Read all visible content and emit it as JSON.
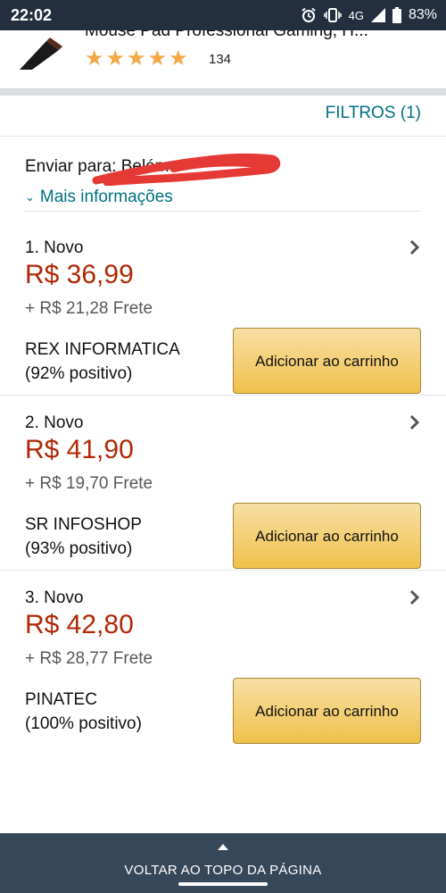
{
  "status_bar": {
    "time": "22:02",
    "network": "4G",
    "battery": "83%"
  },
  "product": {
    "title": "Mouse Pad Professional Gaming, H...",
    "rating_stars": 5,
    "review_count": "134"
  },
  "filters": {
    "label": "FILTROS (1)"
  },
  "delivery": {
    "label": "Enviar para: Belém",
    "more_info": "Mais informações"
  },
  "offers": [
    {
      "number": "1. Novo",
      "price": "R$ 36,99",
      "shipping": "+ R$ 21,28 Frete",
      "seller": "REX INFORMATICA",
      "rating": "(92% positivo)",
      "button": "Adicionar ao carrinho"
    },
    {
      "number": "2. Novo",
      "price": "R$ 41,90",
      "shipping": "+ R$ 19,70 Frete",
      "seller": "SR INFOSHOP",
      "rating": "(93% positivo)",
      "button": "Adicionar ao carrinho"
    },
    {
      "number": "3. Novo",
      "price": "R$ 42,80",
      "shipping": "+ R$ 28,77 Frete",
      "seller": "PINATEC",
      "rating": "(100% positivo)",
      "button": "Adicionar ao carrinho"
    }
  ],
  "footer": {
    "back_to_top": "VOLTAR AO TOPO DA PÁGINA"
  },
  "colors": {
    "status_bar": "#232f3e",
    "price": "#b12704",
    "link": "#007185",
    "button": "#f0c14b",
    "star": "#f3a847",
    "footer": "#37475a"
  },
  "icons": {
    "alarm": "alarm-icon",
    "vibrate": "vibrate-icon",
    "signal": "signal-icon",
    "battery": "battery-icon",
    "star": "star-icon",
    "chevron_right": "chevron-right-icon",
    "chevron_down": "chevron-down-icon",
    "caret_up": "caret-up-icon"
  }
}
